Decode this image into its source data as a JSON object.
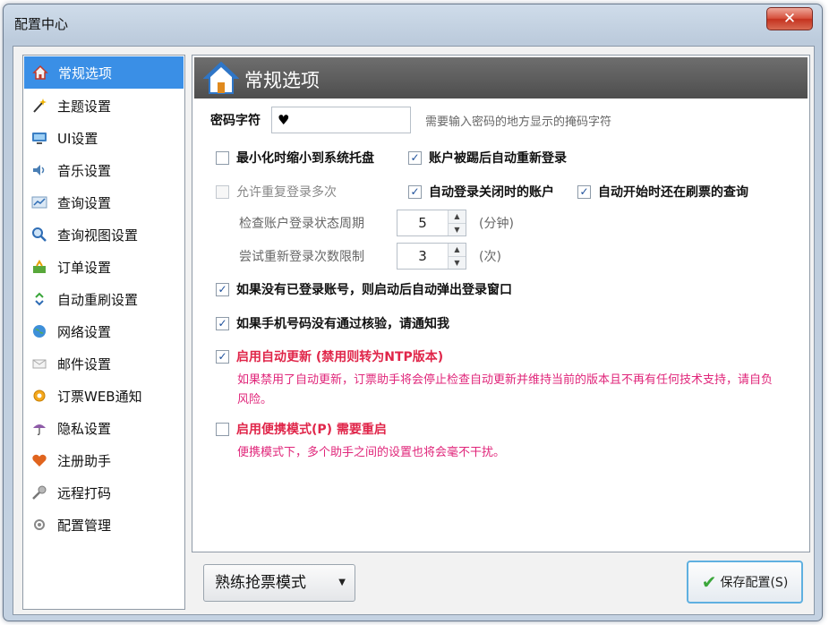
{
  "window": {
    "title": "配置中心",
    "close_glyph": "✕"
  },
  "sidebar": {
    "items": [
      {
        "label": "常规选项",
        "icon": "home-icon",
        "active": true
      },
      {
        "label": "主题设置",
        "icon": "magic-wand-icon"
      },
      {
        "label": "UI设置",
        "icon": "monitor-icon"
      },
      {
        "label": "音乐设置",
        "icon": "speaker-icon"
      },
      {
        "label": "查询设置",
        "icon": "chart-icon"
      },
      {
        "label": "查询视图设置",
        "icon": "magnifier-icon"
      },
      {
        "label": "订单设置",
        "icon": "cart-icon"
      },
      {
        "label": "自动重刷设置",
        "icon": "refresh-icon"
      },
      {
        "label": "网络设置",
        "icon": "globe-icon"
      },
      {
        "label": "邮件设置",
        "icon": "mail-icon"
      },
      {
        "label": "订票WEB通知",
        "icon": "notification-icon"
      },
      {
        "label": "隐私设置",
        "icon": "umbrella-icon"
      },
      {
        "label": "注册助手",
        "icon": "heart-icon"
      },
      {
        "label": "远程打码",
        "icon": "key-icon"
      },
      {
        "label": "配置管理",
        "icon": "config-icon"
      }
    ]
  },
  "content": {
    "title": "常规选项",
    "password_label": "密码字符",
    "password_value": "♥",
    "password_hint": "需要输入密码的地方显示的掩码字符",
    "opt_minimize": {
      "label": "最小化时缩小到系统托盘",
      "checked": false
    },
    "opt_relogin_kicked": {
      "label": "账户被踢后自动重新登录",
      "checked": true
    },
    "opt_allow_repeat": {
      "label": "允许重复登录多次",
      "checked": false,
      "disabled": true
    },
    "opt_auto_login_closed": {
      "label": "自动登录关闭时的账户",
      "checked": true
    },
    "opt_auto_start_query": {
      "label": "自动开始时还在刷票的查询",
      "checked": true
    },
    "check_period_label": "检查账户登录状态周期",
    "check_period_value": "5",
    "check_period_unit": "(分钟)",
    "retry_limit_label": "尝试重新登录次数限制",
    "retry_limit_value": "3",
    "retry_limit_unit": "(次)",
    "opt_popup_login": {
      "label": "如果没有已登录账号，则启动后自动弹出登录窗口",
      "checked": true
    },
    "opt_phone_notify": {
      "label": "如果手机号码没有通过核验，请通知我",
      "checked": true
    },
    "opt_auto_update": {
      "label": "启用自动更新 (禁用则转为NTP版本)",
      "checked": true
    },
    "auto_update_note": "如果禁用了自动更新，订票助手将会停止检查自动更新并维持当前的版本且不再有任何技术支持，请自负风险。",
    "opt_portable": {
      "label": "启用便携模式(P)  需要重启",
      "checked": false
    },
    "portable_note": "便携模式下，多个助手之间的设置也将会毫不干扰。"
  },
  "footer": {
    "mode_select": "熟练抢票模式",
    "save_button": "保存配置(S)"
  },
  "colors": {
    "accent": "#3a8fe6",
    "header_bg": "#5a5a5a",
    "note_red": "#e0267a",
    "label_red": "#e0264a"
  }
}
